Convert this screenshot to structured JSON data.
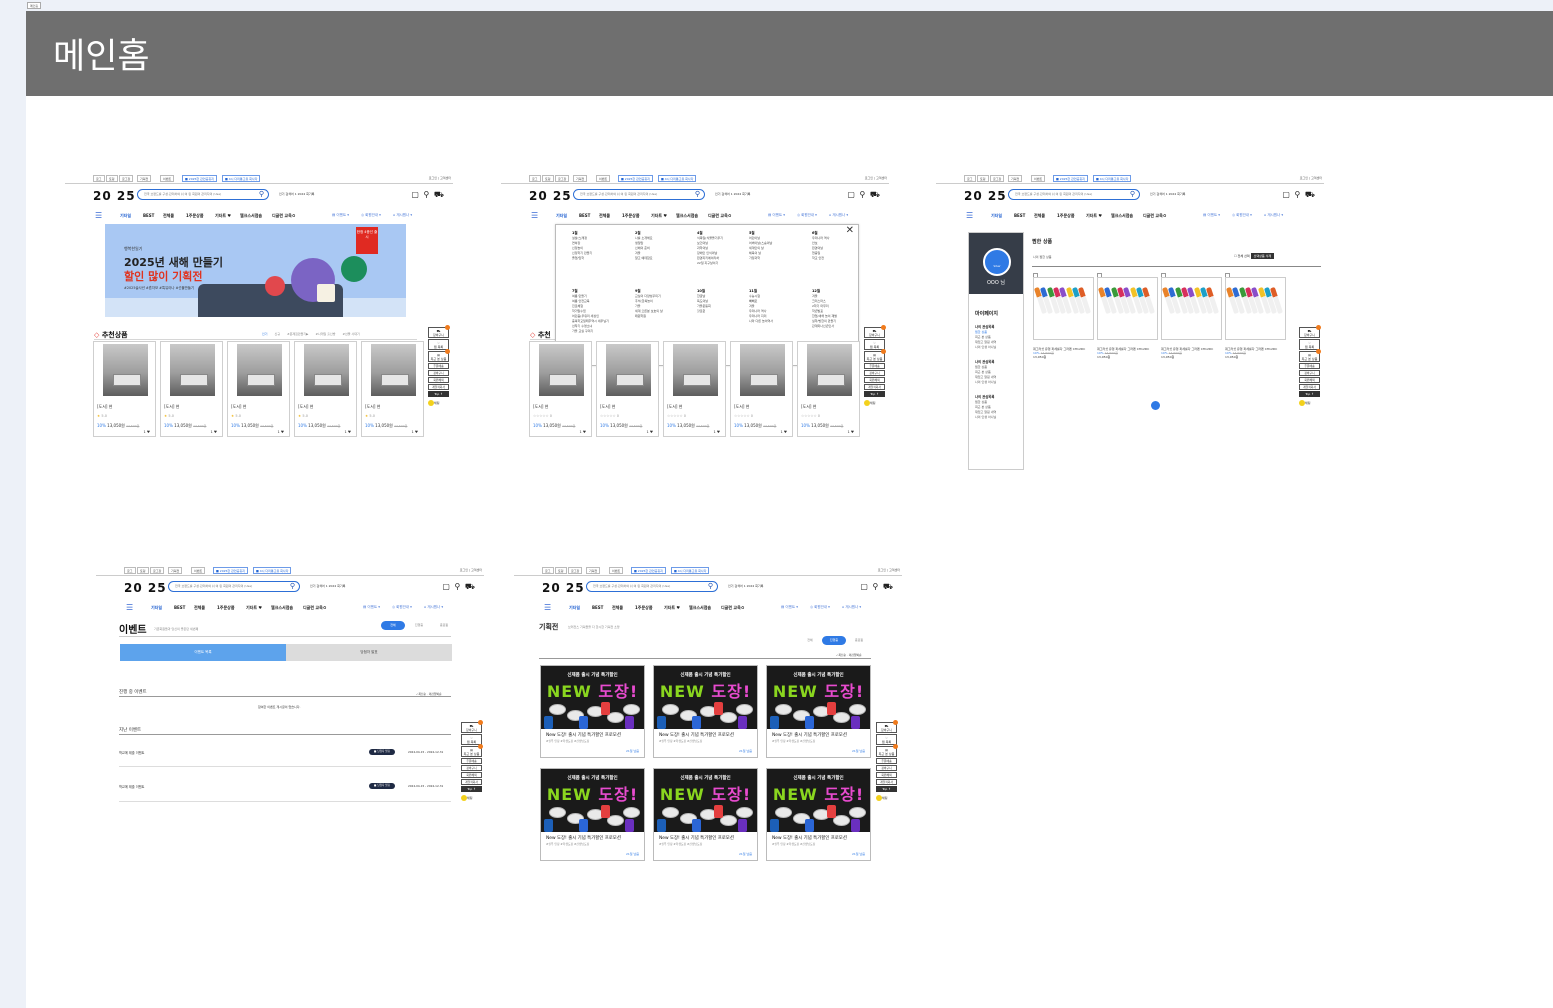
{
  "tab_chip": "메인홈",
  "header": {
    "title": "메인홈"
  },
  "site": {
    "top_chips": [
      "로그",
      "토링",
      "로그장",
      "기획전",
      "이벤트",
      "■ 2025한 관련공휴지",
      "■ 4시 다리통고유 회사자"
    ],
    "top_links": "로그인 | 고객센터",
    "logo": "20  25",
    "search_placeholder": "전국 브랜드를 구성·관리하여 쉬 여 된 회원의 관리자의 (Use)",
    "rank_text": "인기 검색어  1  2024 회기록",
    "header_icons": "▢ ⚲ ⛟",
    "nav": [
      "기타일",
      "BEST",
      "전체몰",
      "1주문상품",
      "기타트 ♥",
      "엘크스서점숍",
      "디글런 교육♻"
    ],
    "nav_right": [
      "▤ 이벤트 ▾",
      "◎ 회원안내 ▾",
      "⌂ 게시원나 ▾"
    ]
  },
  "float_bar": {
    "cart": "장바구니",
    "wish": "찜 목록",
    "recent": "최근 본 상품",
    "links": [
      "주문배송",
      "장바구니",
      "회원혜택",
      "계열적회사"
    ],
    "top": "Top ↑",
    "chat": "채팅"
  },
  "home": {
    "banner_small": "행복한일기",
    "banner_title": "2025년 새해 만들기",
    "banner_highlight": "할인 많이 기획전",
    "banner_sub": "#2025슬사년 #혼자모 #특유아나 #선물만들기",
    "banner_tag": "한정 4종선 출시",
    "section_title": "추천상품",
    "section_tabs": [
      "인기",
      "신규",
      "#문제집만들기▶",
      "#나게일 출산방",
      "#선물 사대기"
    ],
    "cards": [
      {
        "name": "[도서] 현",
        "rating": "5.0",
        "discount": "10%",
        "price": "13,050원",
        "old": "14,500원",
        "like": "1 ♥"
      },
      {
        "name": "[도서] 현",
        "rating": "5.0",
        "discount": "10%",
        "price": "13,050원",
        "old": "14,500원",
        "like": "1 ♥"
      },
      {
        "name": "[도서] 현",
        "rating": "5.0",
        "discount": "10%",
        "price": "13,050원",
        "old": "14,500원",
        "like": "1 ♥"
      },
      {
        "name": "[도서] 현",
        "rating": "5.0",
        "discount": "10%",
        "price": "13,050원",
        "old": "14,500원",
        "like": "1 ♥"
      },
      {
        "name": "[도서] 현",
        "rating": "5.0",
        "discount": "10%",
        "price": "13,050원",
        "old": "14,500원",
        "like": "1 ♥"
      }
    ]
  },
  "menu": {
    "section_title": "추천",
    "stars": "☆☆☆☆☆ 0",
    "months": [
      {
        "title": "1월",
        "items": [
          "설날(노래정",
          "연하장",
          "신정놀이",
          "신정학기 만들기",
          "졸업/입학"
        ]
      },
      {
        "title": "2월",
        "items": [
          "나를 소개해요",
          "생일맘",
          "신체의 준비",
          "겨울",
          "알고 예데함요"
        ]
      },
      {
        "title": "4월",
        "items": [
          "식목일(식물돌기우기",
          "보건의날",
          "과학의날",
          "장애인 인식의날",
          "환경지키에이리하",
          "22일 지구날이기"
        ]
      },
      {
        "title": "5월",
        "items": [
          "어린이날",
          "어버이날(스승의날",
          "세계인의 날",
          "체육의 날",
          "가정과학"
        ]
      },
      {
        "title": "6월",
        "items": [
          "우리나라 역사",
          "안보",
          "환경의날",
          "현충일",
          "학교 안전"
        ]
      },
      {
        "title": "7월",
        "items": [
          "여름 만들기",
          "여름 안전교육",
          "진로체험",
          "학기말수립",
          "어린음(우유리 세상인",
          "중복학교일때주역시 세우닐기",
          "선착기 수영소녀",
          "가을 교실 꾸미기"
        ]
      },
      {
        "title": "9월",
        "items": [
          "교실의 다양성꾸미기",
          "추석(한복놀이",
          "가을",
          "세계 으른분 보호의 날",
          "돼원학원"
        ]
      },
      {
        "title": "10월",
        "items": [
          "한글날",
          "독도의날",
          "가을운동회",
          "할로윈"
        ]
      },
      {
        "title": "11월",
        "items": [
          "수능시험",
          "빼빼로",
          "겨울",
          "우리나라 역사",
          "우리나라 지리",
          "나라 다른 놀이역사"
        ]
      },
      {
        "title": "12월",
        "items": [
          "겨울",
          "크리스마스",
          "2학기 마무리",
          "학년발표",
          "한업/새해 놀이 재발",
          "실학/방한의 만들기",
          "관계되나신년인사"
        ]
      }
    ]
  },
  "wishlist": {
    "side_name": "OOO 님",
    "side_badge": "Silver",
    "side_title": "마이페이지",
    "groups": [
      {
        "title": "나의 관심목록",
        "items": [
          "찜한 상품",
          "최근 본 상품",
          "재입고 알림 내역",
          "나의 인생 아니닐"
        ]
      },
      {
        "title": "나의 관심목록",
        "items": [
          "찜한 상품",
          "최근 본 상품",
          "재입고 알림 내역",
          "나의 인생 아니닐"
        ]
      },
      {
        "title": "나의 관심목록",
        "items": [
          "찜한 상품",
          "최근 본 상품",
          "재입고 알림 내역",
          "나의 인생 아니닐"
        ]
      }
    ],
    "title": "찜한 상품",
    "sub": "나의 찜한 상품",
    "btn_select": "☐ 전체 선택",
    "btn_delete": "선택상품 삭제",
    "products": [
      {
        "name": "워그러섯 유형 파세를다 그라펜 CH12DC",
        "discount": "10%",
        "price": "13,050원",
        "old": "14,500원"
      },
      {
        "name": "워그러섯 유형 파세를다 그라펜 CH12DC",
        "discount": "10%",
        "price": "13,050원",
        "old": "14,500원"
      },
      {
        "name": "워그러섯 유형 파세를다 그라펜 CH12DC",
        "discount": "10%",
        "price": "13,050원",
        "old": "14,500원"
      },
      {
        "name": "워그러섯 유형 파세를다 그라펜 CH12DC",
        "discount": "10%",
        "price": "13,050원",
        "old": "14,500원"
      }
    ]
  },
  "event": {
    "title": "이벤트",
    "desc": "기존회원들과 당신의 좋은던 세번째",
    "pills": [
      "전체",
      "진행중",
      "종료됨"
    ],
    "tab_on": "이벤트 목록",
    "tab_off": "당첨자 발표",
    "ongoing": "진행 중 이벤트",
    "sort": "✓최신순 · 마감임박순",
    "empty": "참여한 이벤트 게시글이 없습니다.",
    "past": "지난 이벤트",
    "rows": [
      {
        "name": "학교에 제출 이벤트",
        "badge": "■ 당첨자 발표",
        "date": "2024-04-15 - 2024-12-31"
      },
      {
        "name": "학교에 제출 이벤트",
        "badge": "■ 당첨자 발표",
        "date": "2024-04-15 - 2024-12-31"
      }
    ]
  },
  "exhibit": {
    "title": "기획전",
    "desc": "브러전스 기획들을 다 한시한 기획전 소망",
    "pills": [
      "전체",
      "진행중",
      "종료됨"
    ],
    "sort": "✓최신순 · 마감임박순",
    "img_line1": "신제품 출시 기념 특가할인",
    "img_new": "NEW",
    "img_dojang": "도장!",
    "card_title": "New 도장! 출시 기념 특가할인 프로모션",
    "card_sub": "#실무 인장 #학생도장 #선생님도장",
    "card_more": "21일 남음"
  }
}
